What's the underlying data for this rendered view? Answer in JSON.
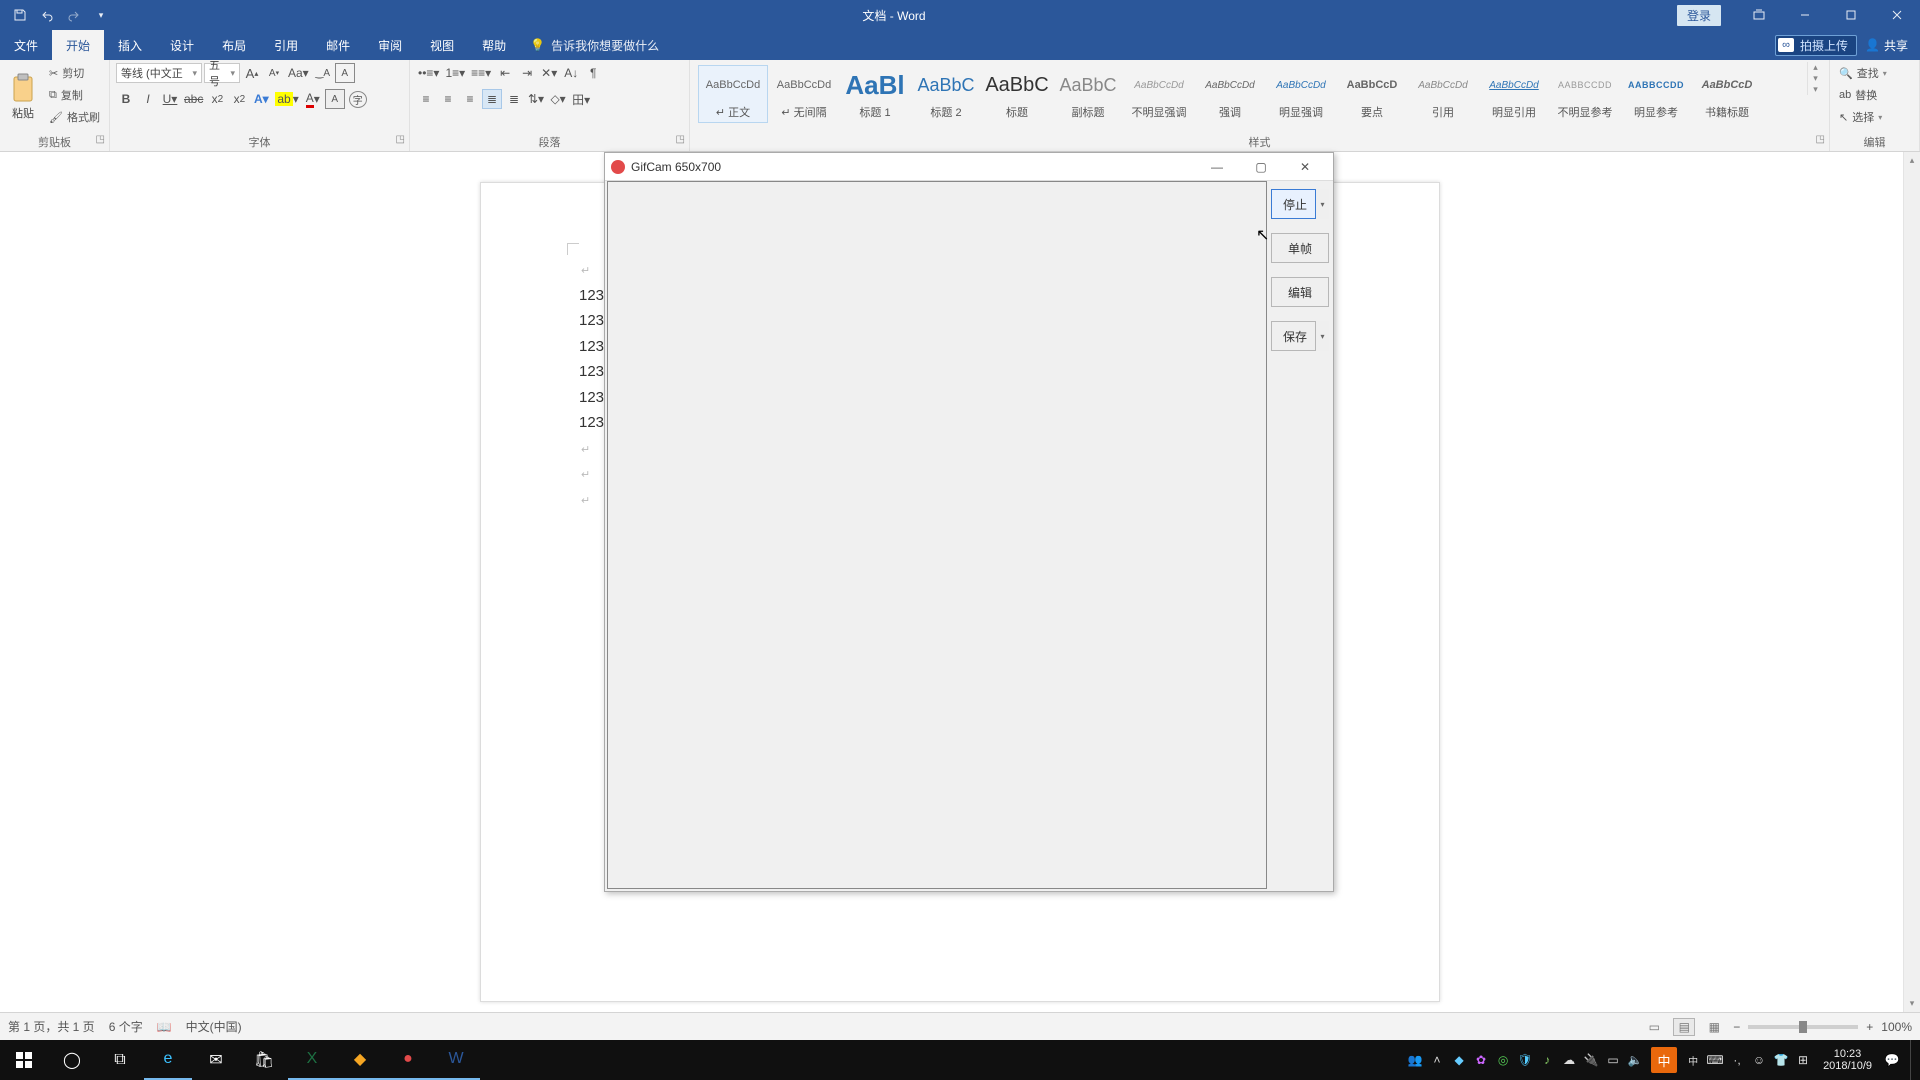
{
  "titlebar": {
    "doc_title": "文档 - Word",
    "login_label": "登录"
  },
  "tabs": {
    "file": "文件",
    "home": "开始",
    "insert": "插入",
    "design": "设计",
    "layout": "布局",
    "references": "引用",
    "mailings": "邮件",
    "review": "审阅",
    "view": "视图",
    "help": "帮助",
    "tellme_placeholder": "告诉我你想要做什么",
    "cloud_label": "拍摄上传",
    "share_label": "共享"
  },
  "ribbon": {
    "clipboard": {
      "paste": "粘贴",
      "cut": "剪切",
      "copy": "复制",
      "format_painter": "格式刷",
      "label": "剪贴板"
    },
    "font": {
      "font_name": "等线 (中文正",
      "font_size": "五号",
      "label": "字体"
    },
    "paragraph": {
      "label": "段落"
    },
    "styles": {
      "label": "样式",
      "items": [
        {
          "preview": "AaBbCcDd",
          "name": "↵ 正文",
          "selected": true,
          "style": "font-size:11px;"
        },
        {
          "preview": "AaBbCcDd",
          "name": "↵ 无间隔",
          "style": "font-size:11px;"
        },
        {
          "preview": "AaBl",
          "name": "标题 1",
          "style": "font-size:26px;color:#2e74b5;font-weight:600;"
        },
        {
          "preview": "AaBbC",
          "name": "标题 2",
          "style": "font-size:18px;color:#2e74b5;"
        },
        {
          "preview": "AaBbC",
          "name": "标题",
          "style": "font-size:20px;color:#333;"
        },
        {
          "preview": "AaBbC",
          "name": "副标题",
          "style": "font-size:18px;color:#888;"
        },
        {
          "preview": "AaBbCcDd",
          "name": "不明显强调",
          "style": "font-size:10px;font-style:italic;color:#999;"
        },
        {
          "preview": "AaBbCcDd",
          "name": "强调",
          "style": "font-size:10px;font-style:italic;color:#666;"
        },
        {
          "preview": "AaBbCcDd",
          "name": "明显强调",
          "style": "font-size:10px;font-style:italic;color:#2e74b5;"
        },
        {
          "preview": "AaBbCcD",
          "name": "要点",
          "style": "font-size:11px;font-weight:700;"
        },
        {
          "preview": "AaBbCcDd",
          "name": "引用",
          "style": "font-size:10px;font-style:italic;color:#888;"
        },
        {
          "preview": "AaBbCcDd",
          "name": "明显引用",
          "style": "font-size:10px;font-style:italic;color:#2e74b5;text-decoration:underline;"
        },
        {
          "preview": "AABBCCDD",
          "name": "不明显参考",
          "style": "font-size:9px;color:#999;letter-spacing:.5px;"
        },
        {
          "preview": "AABBCCDD",
          "name": "明显参考",
          "style": "font-size:9px;color:#2e74b5;letter-spacing:.5px;font-weight:600;"
        },
        {
          "preview": "AaBbCcD",
          "name": "书籍标题",
          "style": "font-size:11px;font-style:italic;font-weight:700;"
        }
      ]
    },
    "editing": {
      "find": "查找",
      "replace": "替换",
      "select": "选择",
      "label": "编辑"
    }
  },
  "document": {
    "lines": [
      "123",
      "123",
      "123",
      "123",
      "123",
      "123"
    ]
  },
  "statusbar": {
    "page_label": "第 1 页，共 1 页",
    "word_count": "6 个字",
    "language": "中文(中国)",
    "zoom": "100%"
  },
  "gifcam": {
    "title": "GifCam  650x700",
    "stop": "停止",
    "frame": "单帧",
    "edit": "编辑",
    "save": "保存"
  },
  "taskbar": {
    "clock_time": "10:23",
    "clock_date": "2018/10/9",
    "ime_letters": "中"
  }
}
